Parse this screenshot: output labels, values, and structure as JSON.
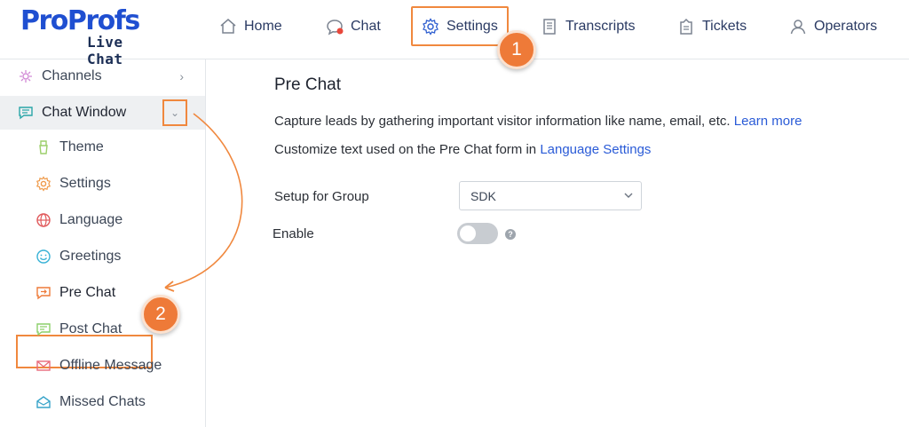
{
  "logo": {
    "main": "ProProfs",
    "sub": "Live Chat"
  },
  "nav": [
    {
      "label": "Home",
      "icon": "home-icon"
    },
    {
      "label": "Chat",
      "icon": "chat-icon"
    },
    {
      "label": "Settings",
      "icon": "gear-icon"
    },
    {
      "label": "Transcripts",
      "icon": "transcript-icon"
    },
    {
      "label": "Tickets",
      "icon": "ticket-icon"
    },
    {
      "label": "Operators",
      "icon": "user-icon"
    }
  ],
  "callouts": {
    "one": "1",
    "two": "2"
  },
  "sidebar": {
    "channels": "Channels",
    "chat_window": "Chat Window",
    "items": [
      {
        "label": "Theme",
        "icon": "theme-icon"
      },
      {
        "label": "Settings",
        "icon": "gear-icon"
      },
      {
        "label": "Language",
        "icon": "globe-icon"
      },
      {
        "label": "Greetings",
        "icon": "smile-icon"
      },
      {
        "label": "Pre Chat",
        "icon": "prechat-icon"
      },
      {
        "label": "Post Chat",
        "icon": "postchat-icon"
      },
      {
        "label": "Offline Message",
        "icon": "mail-icon"
      },
      {
        "label": "Missed Chats",
        "icon": "missed-chat-icon"
      }
    ]
  },
  "main": {
    "title": "Pre Chat",
    "desc1": "Capture leads by gathering important visitor information like name, email, etc.",
    "desc1_link": "Learn more",
    "desc2": "Customize text used on the Pre Chat form in",
    "desc2_link": "Language Settings",
    "group_label": "Setup for Group",
    "group_value": "SDK",
    "enable_label": "Enable",
    "enable_on": false,
    "help_glyph": "?"
  },
  "colors": {
    "accent": "#ee7a38",
    "brand": "#1f4fd1",
    "link": "#2a5bd7"
  }
}
